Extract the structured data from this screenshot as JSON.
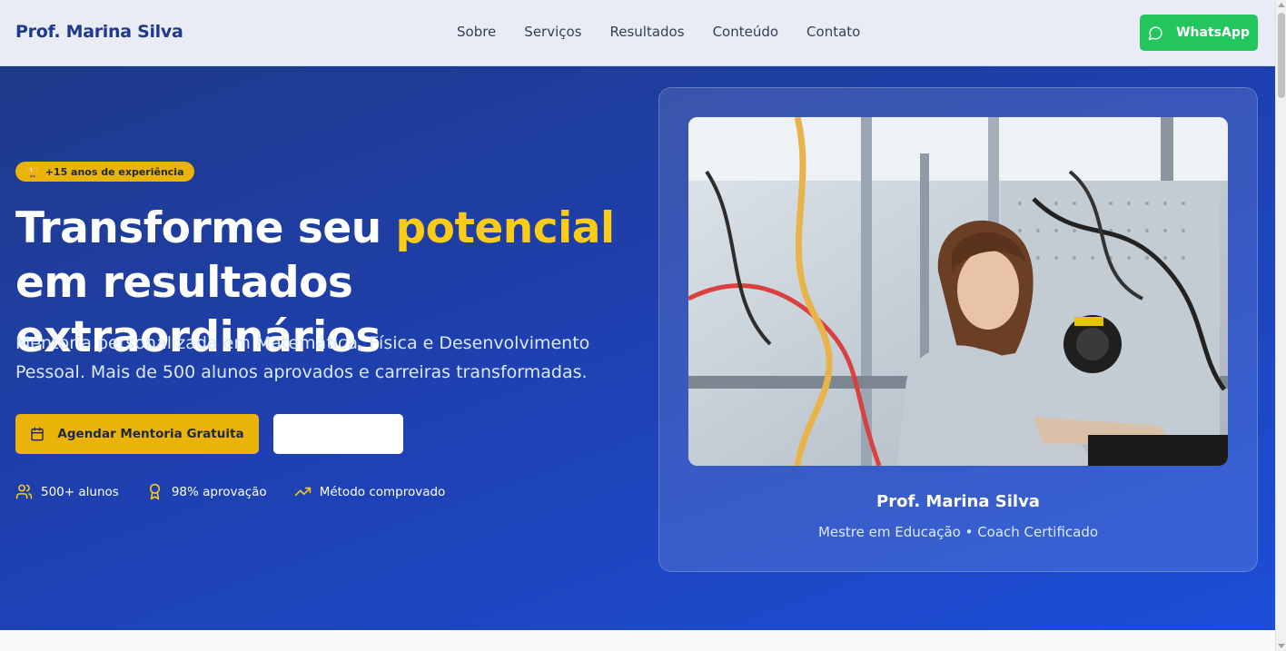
{
  "nav": {
    "brand": "Prof. Marina Silva",
    "links": [
      "Sobre",
      "Serviços",
      "Resultados",
      "Conteúdo",
      "Contato"
    ],
    "whatsapp_label": "WhatsApp"
  },
  "hero": {
    "badge": "+15 anos de experiência",
    "title_part1": "Transforme seu ",
    "title_highlight": "potencial",
    "title_part2": " em resultados extraordinários",
    "subtitle": "Mentoria personalizada em Matemática, Física e Desenvolvimento Pessoal. Mais de 500 alunos aprovados e carreiras transformadas.",
    "cta_primary": "Agendar Mentoria Gratuita",
    "cta_secondary": "",
    "stats": [
      "500+ alunos",
      "98% aprovação",
      "Método comprovado"
    ]
  },
  "profile_card": {
    "name": "Prof. Marina Silva",
    "role": "Mestre em Educação • Coach Certificado"
  },
  "colors": {
    "brand": "#1e3a8a",
    "accent_yellow": "#eab308",
    "whatsapp_green": "#22c55e",
    "hero_bg": "#1e40af"
  },
  "icons": {
    "whatsapp": "message-circle-icon",
    "badge": "trophy-icon",
    "cta_primary": "calendar-icon",
    "stat_0": "users-icon",
    "stat_1": "award-icon",
    "stat_2": "trending-up-icon"
  }
}
